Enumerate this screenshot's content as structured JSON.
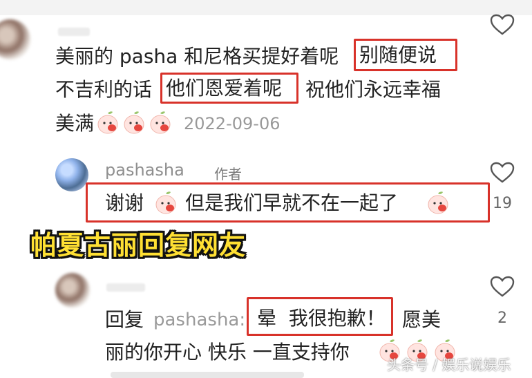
{
  "comment1": {
    "line1": "美丽的 pasha 和尼格买提好着呢",
    "boxed1": "别随便说",
    "line2_pre": "不吉利的话",
    "boxed2": "他们恩爱着呢",
    "line2_post": "祝他们永远幸福",
    "line3": "美满",
    "date": "2022-09-06"
  },
  "comment2": {
    "username": "pashasha",
    "badge": "作者",
    "reply_pre": "谢谢",
    "reply_post": "但是我们早就不在一起了",
    "likes": "19"
  },
  "caption": "帕夏古丽回复网友",
  "comment3": {
    "reply_label": "回复",
    "mention": "pashasha:",
    "boxed": "晕  我很抱歉！",
    "line1_post": "愿美",
    "line2": "丽的你开心 快乐 一直支持你",
    "likes": "2"
  },
  "watermark": "头条号 / 娱乐说娱乐",
  "icons": {
    "like": "heart-outline-icon",
    "emoji": "peach-face-emoji"
  },
  "colors": {
    "highlight_box": "#d8322a",
    "caption_fill": "#ffe033"
  }
}
